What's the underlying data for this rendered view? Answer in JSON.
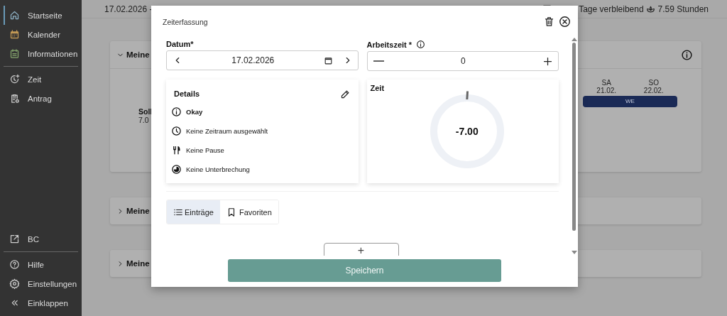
{
  "sidebar": {
    "top_items": [
      {
        "label": "Startseite",
        "selected": true
      },
      {
        "label": "Kalender",
        "selected": false
      },
      {
        "label": "Informationen",
        "selected": false
      }
    ],
    "middle_items": [
      {
        "label": "Zeit",
        "selected": false
      },
      {
        "label": "Antrag",
        "selected": false
      }
    ],
    "link_items": [
      {
        "label": "BC",
        "selected": false
      }
    ],
    "bottom_items": [
      {
        "label": "Hilfe",
        "selected": false
      },
      {
        "label": "Einstellungen",
        "selected": false
      },
      {
        "label": "Einklappen",
        "selected": false
      }
    ]
  },
  "header": {
    "date": "17.02.2026 -",
    "remaining": "Tage verbleibend",
    "hours": "7.59 Stunden"
  },
  "cards": [
    {
      "title": "Meine",
      "expanded": true,
      "summary_label": "Soll",
      "summary_value": "7.0",
      "days": [
        {
          "weekday": "SA",
          "date": "21.02."
        },
        {
          "weekday": "SO",
          "date": "22.02."
        }
      ],
      "badge": "WE"
    },
    {
      "title": "Meine",
      "expanded": false
    },
    {
      "title": "Meine",
      "expanded": false
    }
  ],
  "dialog": {
    "title": "Zeiterfassung",
    "date_field": {
      "label": "Datum*",
      "value": "17.02.2026"
    },
    "work_field": {
      "label": "Arbeitszeit *",
      "value": "0"
    },
    "details": {
      "title": "Details",
      "rows": [
        {
          "kind": "status",
          "text": "Okay"
        },
        {
          "kind": "note",
          "text": "Keine Zeitraum ausgewählt"
        },
        {
          "kind": "note",
          "text": "Keine Pause"
        },
        {
          "kind": "note",
          "text": "Keine Unterbrechung"
        }
      ]
    },
    "time": {
      "title": "Zeit",
      "value": "-7.00"
    },
    "tabs": [
      {
        "label": "Einträge",
        "selected": true
      },
      {
        "label": "Favoriten",
        "selected": false
      }
    ],
    "add_button": "+",
    "save_button": "Speichern"
  }
}
